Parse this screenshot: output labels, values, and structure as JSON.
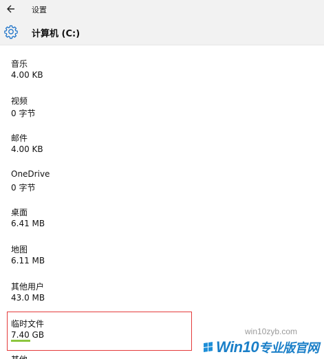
{
  "titlebar": {
    "title": "设置",
    "back_icon": "arrow-left-icon"
  },
  "header": {
    "title": "计算机 (C:)",
    "icon": "gear-icon"
  },
  "items": [
    {
      "name": "音乐",
      "size": "4.00 KB"
    },
    {
      "name": "视频",
      "size": "0 字节"
    },
    {
      "name": "邮件",
      "size": "4.00 KB"
    },
    {
      "name": "OneDrive",
      "size": "0 字节"
    },
    {
      "name": "桌面",
      "size": "6.41 MB"
    },
    {
      "name": "地图",
      "size": "6.11 MB"
    },
    {
      "name": "其他用户",
      "size": "43.0 MB"
    },
    {
      "name": "临时文件",
      "size": "7.40 GB",
      "usage_fraction": 0.12
    },
    {
      "name": "其他"
    }
  ],
  "watermark": {
    "brand": "Win10",
    "suffix": "专业版官网",
    "site": "win10zyb.com"
  },
  "colors": {
    "accent": "#1e8fd8",
    "highlight_border": "#e43a3a",
    "usage_bar": "#8cc63e",
    "chrome_bg": "#f2f2f2"
  }
}
